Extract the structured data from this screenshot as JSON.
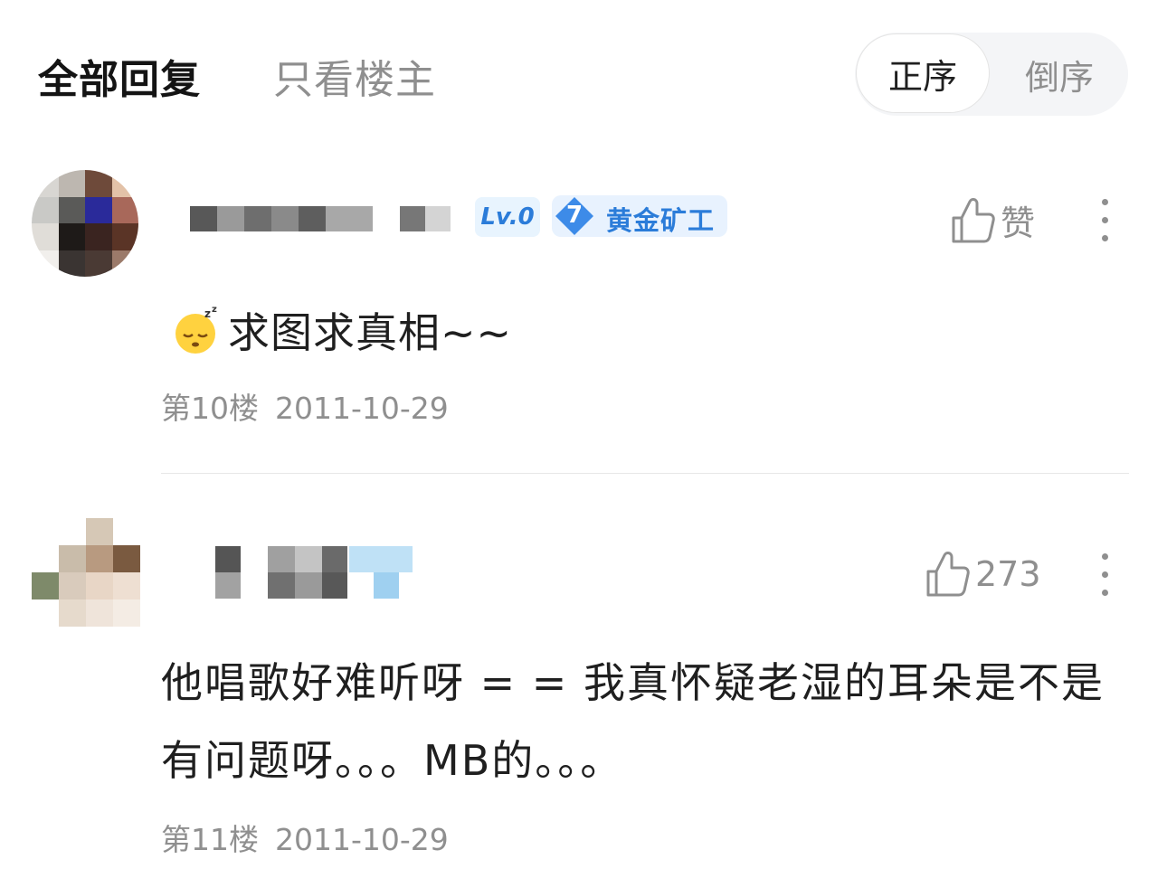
{
  "header": {
    "tab_all": "全部回复",
    "tab_op_only": "只看楼主",
    "sort_asc": "正序",
    "sort_desc": "倒序"
  },
  "comments": [
    {
      "level_badge": "Lv.0",
      "rank_number": "7",
      "rank_title": "黄金矿工",
      "like_label": "赞",
      "text": "求图求真相~~",
      "floor": "第10楼",
      "date": "2011-10-29"
    },
    {
      "like_count": "273",
      "text": "他唱歌好难听呀 = = 我真怀疑老湿的耳朵是不是有问题呀。。。MB的。。。",
      "floor": "第11楼",
      "date": "2011-10-29"
    }
  ],
  "colors": {
    "accent_blue": "#2b7cd9",
    "muted_text": "#8f8f8f",
    "primary_text": "#1f1f1f"
  },
  "icons": [
    "thumbs-up-icon",
    "more-vertical-icon",
    "sleepy-face-emoji",
    "rank-diamond-icon"
  ]
}
